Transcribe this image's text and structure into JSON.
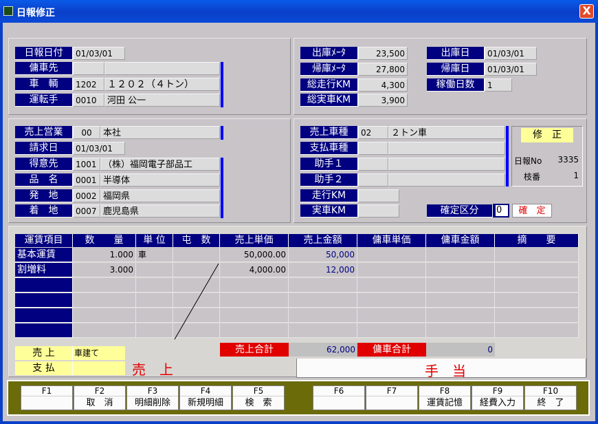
{
  "window": {
    "title": "日報修正",
    "close": "X"
  },
  "top_left": {
    "nippo_date_label": "日報日付",
    "nippo_date": "01/03/01",
    "yousha_label": "傭車先",
    "sharyo_label": "車　輌",
    "sharyo_code": "1202",
    "sharyo_name": "１２０２（４トン）",
    "driver_label": "運転手",
    "driver_code": "0010",
    "driver_name": "河田 公一"
  },
  "top_right": {
    "depart_meter_label": "出庫ﾒｰﾀ",
    "depart_meter": "23,500",
    "return_meter_label": "帰庫ﾒｰﾀ",
    "return_meter": "27,800",
    "total_km_label": "総走行KM",
    "total_km": "4,300",
    "actual_km_label": "総実車KM",
    "actual_km": "3,900",
    "depart_date_label": "出庫日",
    "depart_date": "01/03/01",
    "return_date_label": "帰庫日",
    "return_date": "01/03/01",
    "work_days_label": "稼働日数",
    "work_days": "1"
  },
  "mid_left": {
    "sales_office_label": "売上営業",
    "sales_office_code": "00",
    "sales_office_name": "本社",
    "invoice_date_label": "請求日",
    "invoice_date": "01/03/01",
    "customer_label": "得意先",
    "customer_code": "1001",
    "customer_name": "（株）福岡電子部品工",
    "item_label": "品　名",
    "item_code": "0001",
    "item_name": "半導体",
    "origin_label": "発　地",
    "origin_code": "0002",
    "origin_name": "福岡県",
    "dest_label": "着　地",
    "dest_code": "0007",
    "dest_name": "鹿児島県"
  },
  "mid_right": {
    "sales_type_label": "売上車種",
    "sales_type_code": "02",
    "sales_type_name": "２トン車",
    "pay_type_label": "支払車種",
    "helper1_label": "助手１",
    "helper2_label": "助手２",
    "run_km_label": "走行KM",
    "real_km_label": "実車KM",
    "status": "修　正",
    "nippo_no_label": "日報No",
    "nippo_no": "3335",
    "branch_label": "枝番",
    "branch": "1",
    "confirm_label": "確定区分",
    "confirm_value": "0",
    "confirm_text": "確　定"
  },
  "table": {
    "headers": [
      "運賃項目",
      "数　　量",
      "単 位",
      "屯　数",
      "売上単価",
      "売上金額",
      "傭車単価",
      "傭車金額",
      "摘　　要"
    ],
    "rows": [
      {
        "item": "基本運賃",
        "qty": "1.000",
        "unit": "車",
        "price": "50,000.00",
        "amount": "50,000"
      },
      {
        "item": "割増料",
        "qty": "3.000",
        "unit": "",
        "price": "4,000.00",
        "amount": "12,000"
      }
    ],
    "sales_total_label": "売上合計",
    "sales_total": "62,000",
    "charter_total_label": "傭車合計",
    "charter_total": "0"
  },
  "footer": {
    "uriage_label": "売 上",
    "uriage_value": "車建て",
    "shiharai_label": "支 払",
    "big_left": "売　上",
    "big_right": "手　当"
  },
  "fkeys": [
    {
      "key": "F1",
      "name": ""
    },
    {
      "key": "F2",
      "name": "取　消"
    },
    {
      "key": "F3",
      "name": "明細削除"
    },
    {
      "key": "F4",
      "name": "新規明細"
    },
    {
      "key": "F5",
      "name": "検　索"
    },
    {
      "key": "F6",
      "name": ""
    },
    {
      "key": "F7",
      "name": ""
    },
    {
      "key": "F8",
      "name": "運賃記憶"
    },
    {
      "key": "F9",
      "name": "経費入力"
    },
    {
      "key": "F10",
      "name": "終　了"
    }
  ],
  "colors": {
    "label_bg": "#000080",
    "accent_red": "#e00000",
    "highlight_yellow": "#ffff99",
    "title_blue": "#0a5ae8"
  }
}
